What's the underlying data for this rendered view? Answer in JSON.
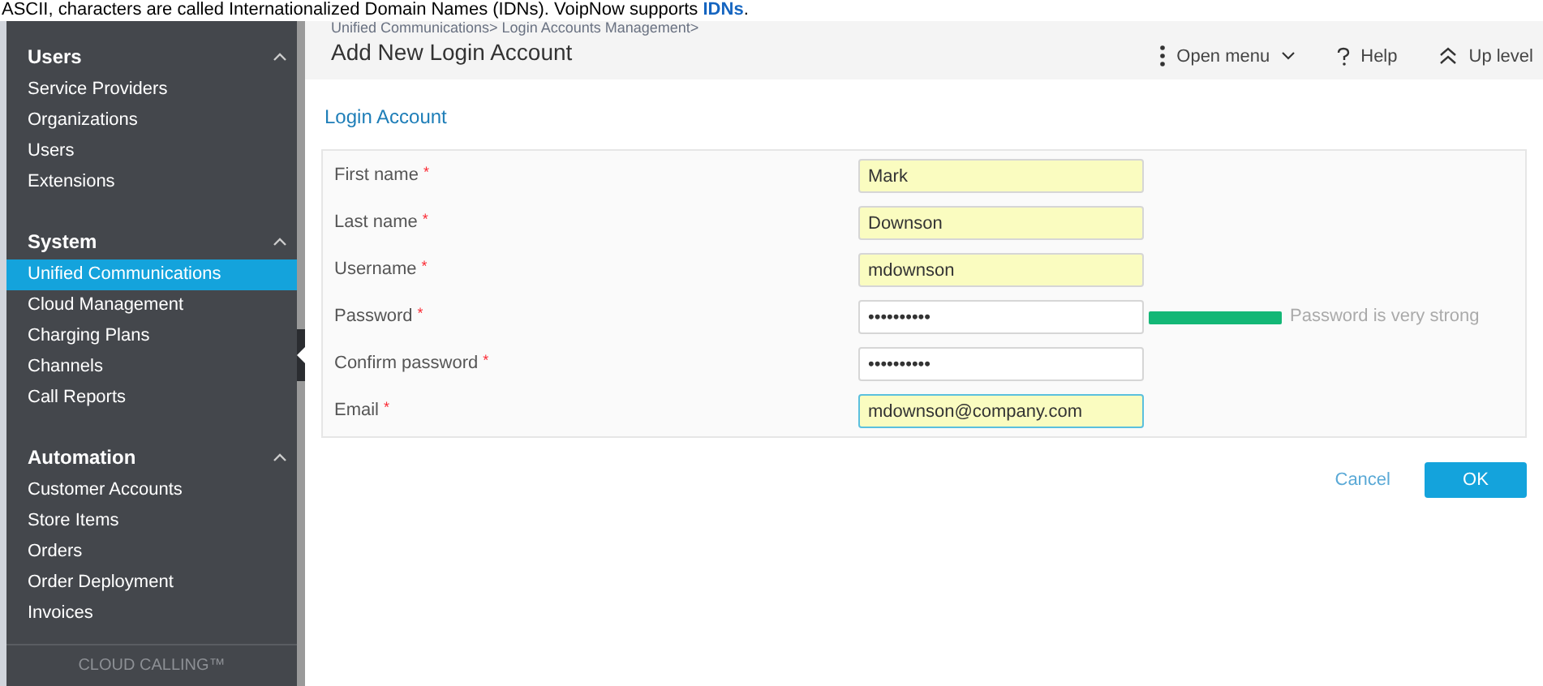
{
  "doc_text": "ASCII, characters are called Internationalized Domain Names (IDNs). VoipNow supports **IDNs**.",
  "sidebar": {
    "sections": [
      {
        "title": "Users",
        "expanded": true,
        "items": [
          {
            "label": "Service Providers",
            "selected": false
          },
          {
            "label": "Organizations",
            "selected": false
          },
          {
            "label": "Users",
            "selected": false
          },
          {
            "label": "Extensions",
            "selected": false
          }
        ]
      },
      {
        "title": "System",
        "expanded": true,
        "items": [
          {
            "label": "Unified Communications",
            "selected": true
          },
          {
            "label": "Cloud Management",
            "selected": false
          },
          {
            "label": "Charging Plans",
            "selected": false
          },
          {
            "label": "Channels",
            "selected": false
          },
          {
            "label": "Call Reports",
            "selected": false
          }
        ]
      },
      {
        "title": "Automation",
        "expanded": true,
        "items": [
          {
            "label": "Customer Accounts",
            "selected": false
          },
          {
            "label": "Store Items",
            "selected": false
          },
          {
            "label": "Orders",
            "selected": false
          },
          {
            "label": "Order Deployment",
            "selected": false
          },
          {
            "label": "Invoices",
            "selected": false
          }
        ]
      }
    ],
    "footer": "CLOUD CALLING™"
  },
  "header": {
    "breadcrumb": "Unified Communications> Login Accounts Management>",
    "title": "Add New Login Account",
    "actions": [
      {
        "kind": "menu",
        "label": "Open menu"
      },
      {
        "kind": "help",
        "label": "Help"
      },
      {
        "kind": "up",
        "label": "Up level"
      }
    ]
  },
  "section_title": "Login Account",
  "fields": [
    {
      "label": "First name",
      "required_mark": "*",
      "value": "Mark",
      "autofilled": true,
      "focused": false
    },
    {
      "label": "Last name",
      "required_mark": "*",
      "value": "Downson",
      "autofilled": true,
      "focused": false
    },
    {
      "label": "Username",
      "required_mark": "*",
      "value": "mdownson",
      "autofilled": true,
      "focused": false
    },
    {
      "label": "Password",
      "required_mark": "*",
      "value": "••••••••••",
      "autofilled": false,
      "focused": false,
      "strength": {
        "level": 1,
        "text": "Password is very strong"
      }
    },
    {
      "label": "Confirm password",
      "required_mark": "*",
      "value": "••••••••••",
      "autofilled": false,
      "focused": false
    },
    {
      "label": "Email",
      "required_mark": "*",
      "value": "mdownson@company.com",
      "autofilled": true,
      "focused": true
    }
  ],
  "buttons": [
    {
      "kind": "cancel",
      "label": "Cancel"
    },
    {
      "kind": "ok",
      "label": "OK"
    }
  ]
}
